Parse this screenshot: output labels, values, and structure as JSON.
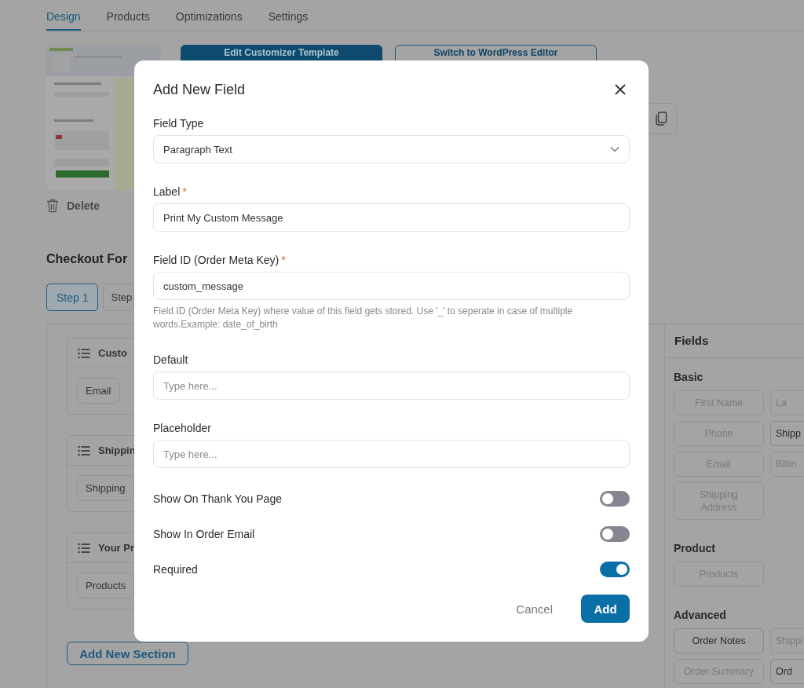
{
  "tabs": [
    {
      "label": "Design",
      "selected": true
    },
    {
      "label": "Products",
      "selected": false
    },
    {
      "label": "Optimizations",
      "selected": false
    },
    {
      "label": "Settings",
      "selected": false
    }
  ],
  "template_actions": {
    "edit_button": "Edit Customizer Template",
    "switch_button": "Switch to WordPress Editor",
    "delete_label": "Delete"
  },
  "checkout_form": {
    "title": "Checkout For",
    "steps": [
      {
        "label": "Step 1",
        "selected": true
      },
      {
        "label": "Step",
        "selected": false
      }
    ],
    "sections": [
      {
        "title": "Custo",
        "fields": [
          "Email"
        ]
      },
      {
        "title": "Shippin",
        "fields": [
          "Shipping"
        ]
      },
      {
        "title": "Your Pr",
        "fields": [
          "Products"
        ]
      }
    ],
    "add_section_button": "Add New Section"
  },
  "fields_panel": {
    "title": "Fields",
    "groups": [
      {
        "title": "Basic",
        "items": [
          {
            "label": "First Name",
            "disabled": true
          },
          {
            "label": "La",
            "disabled": true
          },
          {
            "label": "Phone",
            "disabled": true
          },
          {
            "label": "Shipp",
            "disabled": false
          },
          {
            "label": "Email",
            "disabled": true
          },
          {
            "label": "Billin",
            "disabled": true
          },
          {
            "label": "Shipping Address",
            "disabled": true
          }
        ]
      },
      {
        "title": "Product",
        "items": [
          {
            "label": "Products",
            "disabled": true
          }
        ]
      },
      {
        "title": "Advanced",
        "items": [
          {
            "label": "Order Notes",
            "disabled": false
          },
          {
            "label": "Shippi",
            "disabled": true
          },
          {
            "label": "Order Summary",
            "disabled": true
          },
          {
            "label": "Ord",
            "disabled": false
          }
        ]
      }
    ]
  },
  "modal": {
    "title": "Add New Field",
    "required_symbol": "*",
    "fields": [
      {
        "kind": "select",
        "label": "Field Type",
        "value": "Paragraph Text",
        "required": false
      },
      {
        "kind": "text",
        "label": "Label",
        "value": "Print My Custom Message",
        "required": true
      },
      {
        "kind": "text",
        "label": "Field ID (Order Meta Key)",
        "value": "custom_message",
        "required": true,
        "help": "Field ID (Order Meta Key) where value of this field gets stored. Use '_' to seperate in case of multiple words.Example: date_of_birth"
      },
      {
        "kind": "text",
        "label": "Default",
        "placeholder": "Type here...",
        "required": false
      },
      {
        "kind": "text",
        "label": "Placeholder",
        "placeholder": "Type here...",
        "required": false
      }
    ],
    "toggles": [
      {
        "label": "Show On Thank You Page",
        "on": false
      },
      {
        "label": "Show In Order Email",
        "on": false
      },
      {
        "label": "Required",
        "on": true
      }
    ],
    "cancel_button": "Cancel",
    "add_button": "Add"
  }
}
